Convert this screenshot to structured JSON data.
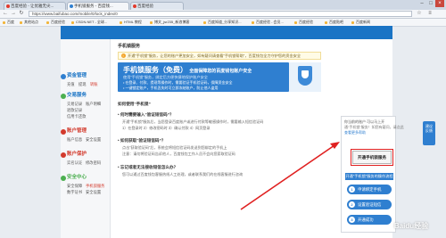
{
  "browser": {
    "tabs": [
      {
        "label": "百度经验 - 让优雅无尖..."
      },
      {
        "label": "手机锁服务 - 百度钱..."
      },
      {
        "label": "百度经验"
      }
    ],
    "url": "https://www.baifubao.com/mobile/0/lock_index/0",
    "bookmarks": [
      {
        "label": "百度"
      },
      {
        "label": "其他站点"
      },
      {
        "label": "百度经验"
      },
      {
        "label": "CSDN.NET - 全球..."
      },
      {
        "label": "HTML 教程"
      },
      {
        "label": "博文_jsr235_新浪博客"
      },
      {
        "label": "百度知道_分享知识..."
      },
      {
        "label": "百度经验 - 会员..."
      },
      {
        "label": "百度经验"
      },
      {
        "label": "百度贴吧"
      },
      {
        "label": "百度新闻"
      }
    ]
  },
  "sidebar": {
    "sections": [
      {
        "title": "资金管理",
        "items": [
          "充值",
          "提现",
          "转账"
        ]
      },
      {
        "title": "交易服务",
        "items": [
          "交易记录",
          "账户明细",
          "退款记录",
          "信用卡还款"
        ]
      },
      {
        "title": "账户管理",
        "items": [
          "账户信息",
          "安全设置"
        ]
      },
      {
        "title": "账户保护",
        "items": [
          "实名认证",
          "修改密码"
        ]
      },
      {
        "title": "安全中心",
        "items": [
          "安全保障",
          "手机锁服务",
          "数字证书",
          "安全设置"
        ]
      }
    ]
  },
  "content": {
    "breadcrumb": "手机锁服务",
    "notice": "开通“手机锁”服务，让您的账户更加安全，如有疑问请查看“手机锁帮助”，百度钱包全力守护您的资金安全",
    "banner": {
      "title": "手机锁服务（免费）",
      "title2": "全面保障您的百度钱包账户安全",
      "subtitle": "使用“手机锁”服务，绑定后方便快捷地保护账户安全",
      "bullets": [
        "• 在登录、付款、提现等操作时，需要验证手机验证码，保障资金安全",
        "• 一键锁定账户，手机丢失时可立即冻结账户，防止他人盗用"
      ]
    },
    "how": {
      "title": "如何使用“手机锁”",
      "items": [
        {
          "q": "• 何时需要输入“验证短信码”？",
          "a": "开通“手机锁”服务后，当您登录百度账户或进行付款等敏感操作时，需要输入短信验证码"
        },
        {
          "q": "",
          "a": "1）在登录时   2）修改密码时   3）确认付款   4）网页登录"
        },
        {
          "q": "• 如何获取“验证短信码”？",
          "a": "点击“获取验证码”后，系统会将短信验证码发送到您绑定的手机上"
        },
        {
          "q": "",
          "a": "注意：请勿将验证码告诉他人，百度钱包工作人员不会向您索取验证码"
        },
        {
          "q": "• 忘记或者无法接收短信怎么办？",
          "a": "您可以通过百度钱包客服热线人工处理，或者联系我们的在线客服进行咨询"
        }
      ]
    }
  },
  "rightbox": {
    "line1": "你当前的账户        可以马上开",
    "line2": "通“手机锁”服务！如您有疑问，请点此",
    "line3": "查看更多帮助",
    "open_button": "开通手机锁服务",
    "flow_title": "开通“手机锁”服务的操作流程",
    "steps": [
      {
        "num": "1",
        "label": "申请绑定手机"
      },
      {
        "num": "2",
        "label": "设置验证短信"
      },
      {
        "num": "3",
        "label": "开通成功"
      }
    ]
  },
  "float_tab": {
    "label": "建议反馈"
  },
  "watermark": "Baidu经验"
}
